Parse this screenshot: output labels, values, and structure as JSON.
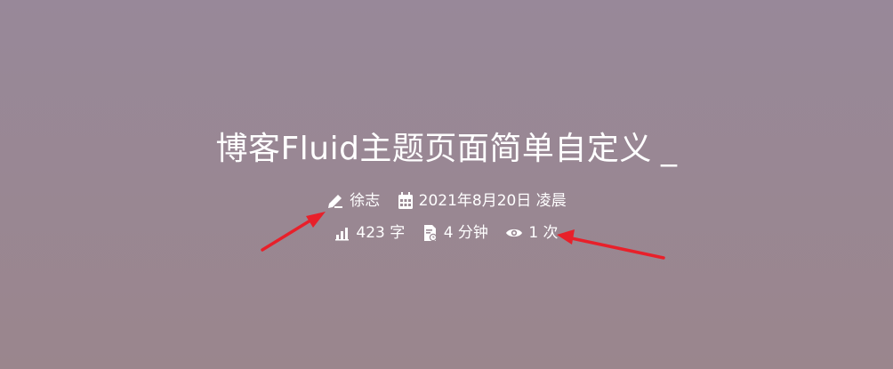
{
  "post": {
    "title": "博客Fluid主题页面简单自定义",
    "cursor": "_",
    "author": "徐志",
    "date": "2021年8月20日 凌晨",
    "words": "423 字",
    "read_time": "4 分钟",
    "views": "1 次"
  },
  "icons": {
    "author": "pen-icon",
    "date": "calendar-icon",
    "words": "bar-chart-icon",
    "read_time": "document-clock-icon",
    "views": "eye-icon"
  },
  "colors": {
    "background_top": "#988899",
    "background_bottom": "#9a868d",
    "text": "#ffffff",
    "annotation_arrow": "#e8202a"
  }
}
